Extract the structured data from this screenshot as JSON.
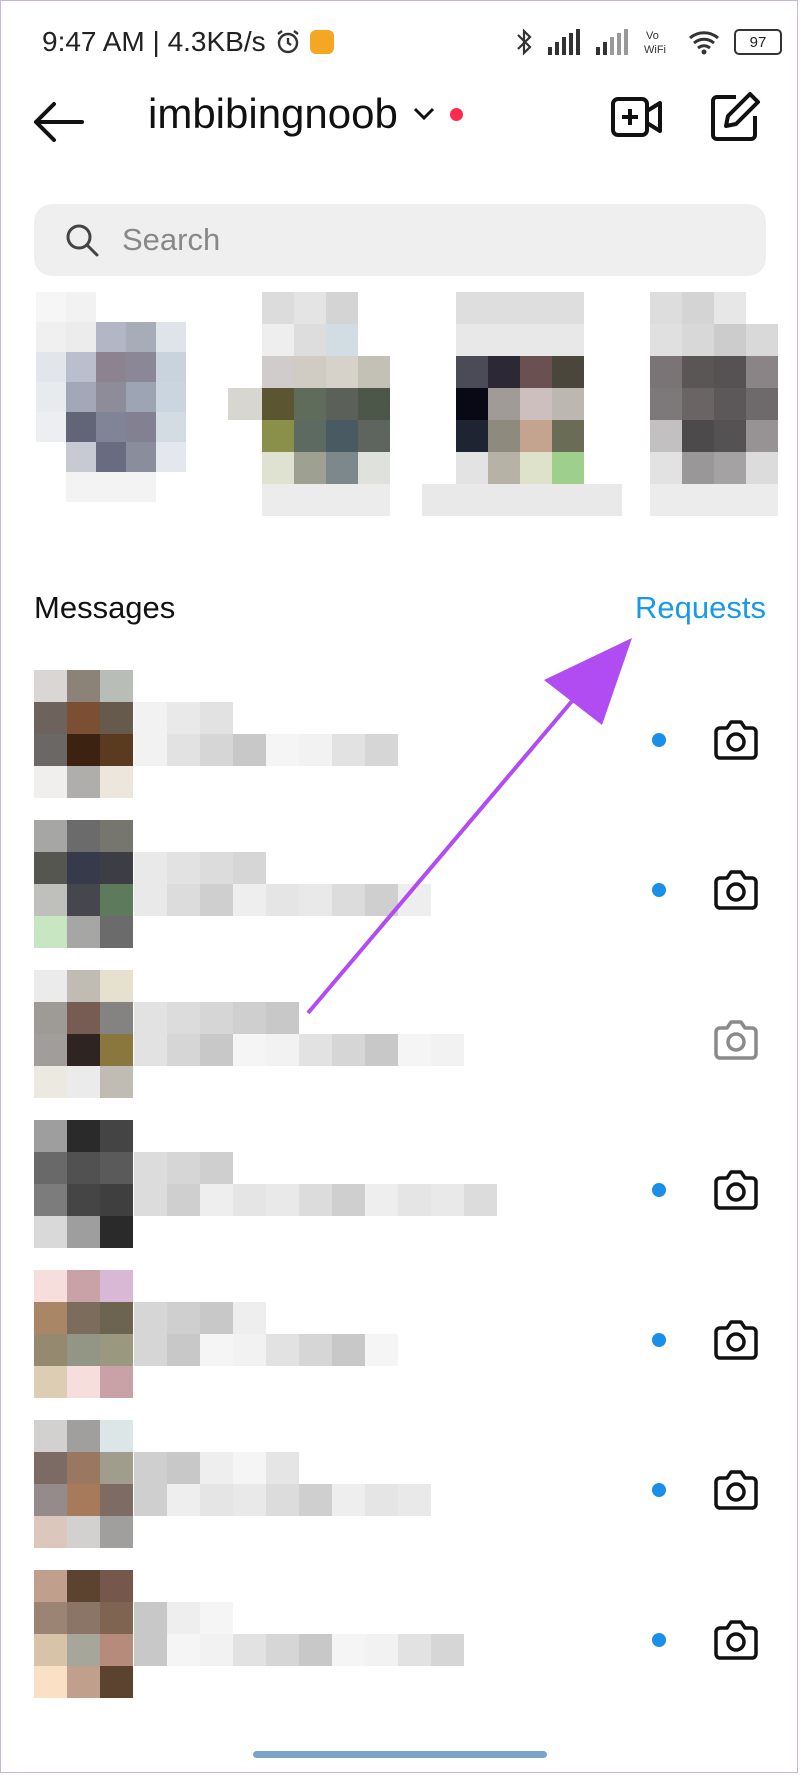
{
  "status_bar": {
    "time": "9:47 AM | 4.3KB/s",
    "battery": "97"
  },
  "header": {
    "username": "imbibingnoob"
  },
  "search": {
    "placeholder": "Search"
  },
  "section": {
    "messages_label": "Messages",
    "requests_label": "Requests"
  },
  "threads": [
    {
      "unread": true,
      "camera_active": true
    },
    {
      "unread": true,
      "camera_active": true
    },
    {
      "unread": false,
      "camera_active": false
    },
    {
      "unread": true,
      "camera_active": true
    },
    {
      "unread": true,
      "camera_active": true
    },
    {
      "unread": true,
      "camera_active": true
    },
    {
      "unread": true,
      "camera_active": true
    }
  ],
  "colors": {
    "accent": "#1a9ae6",
    "unread_dot": "#1a8fe8",
    "live_dot": "#ff2a4d",
    "annotation_arrow": "#b14cf2"
  },
  "icons": [
    "back-arrow-icon",
    "chevron-down-icon",
    "video-add-icon",
    "compose-icon",
    "search-icon",
    "camera-icon"
  ]
}
